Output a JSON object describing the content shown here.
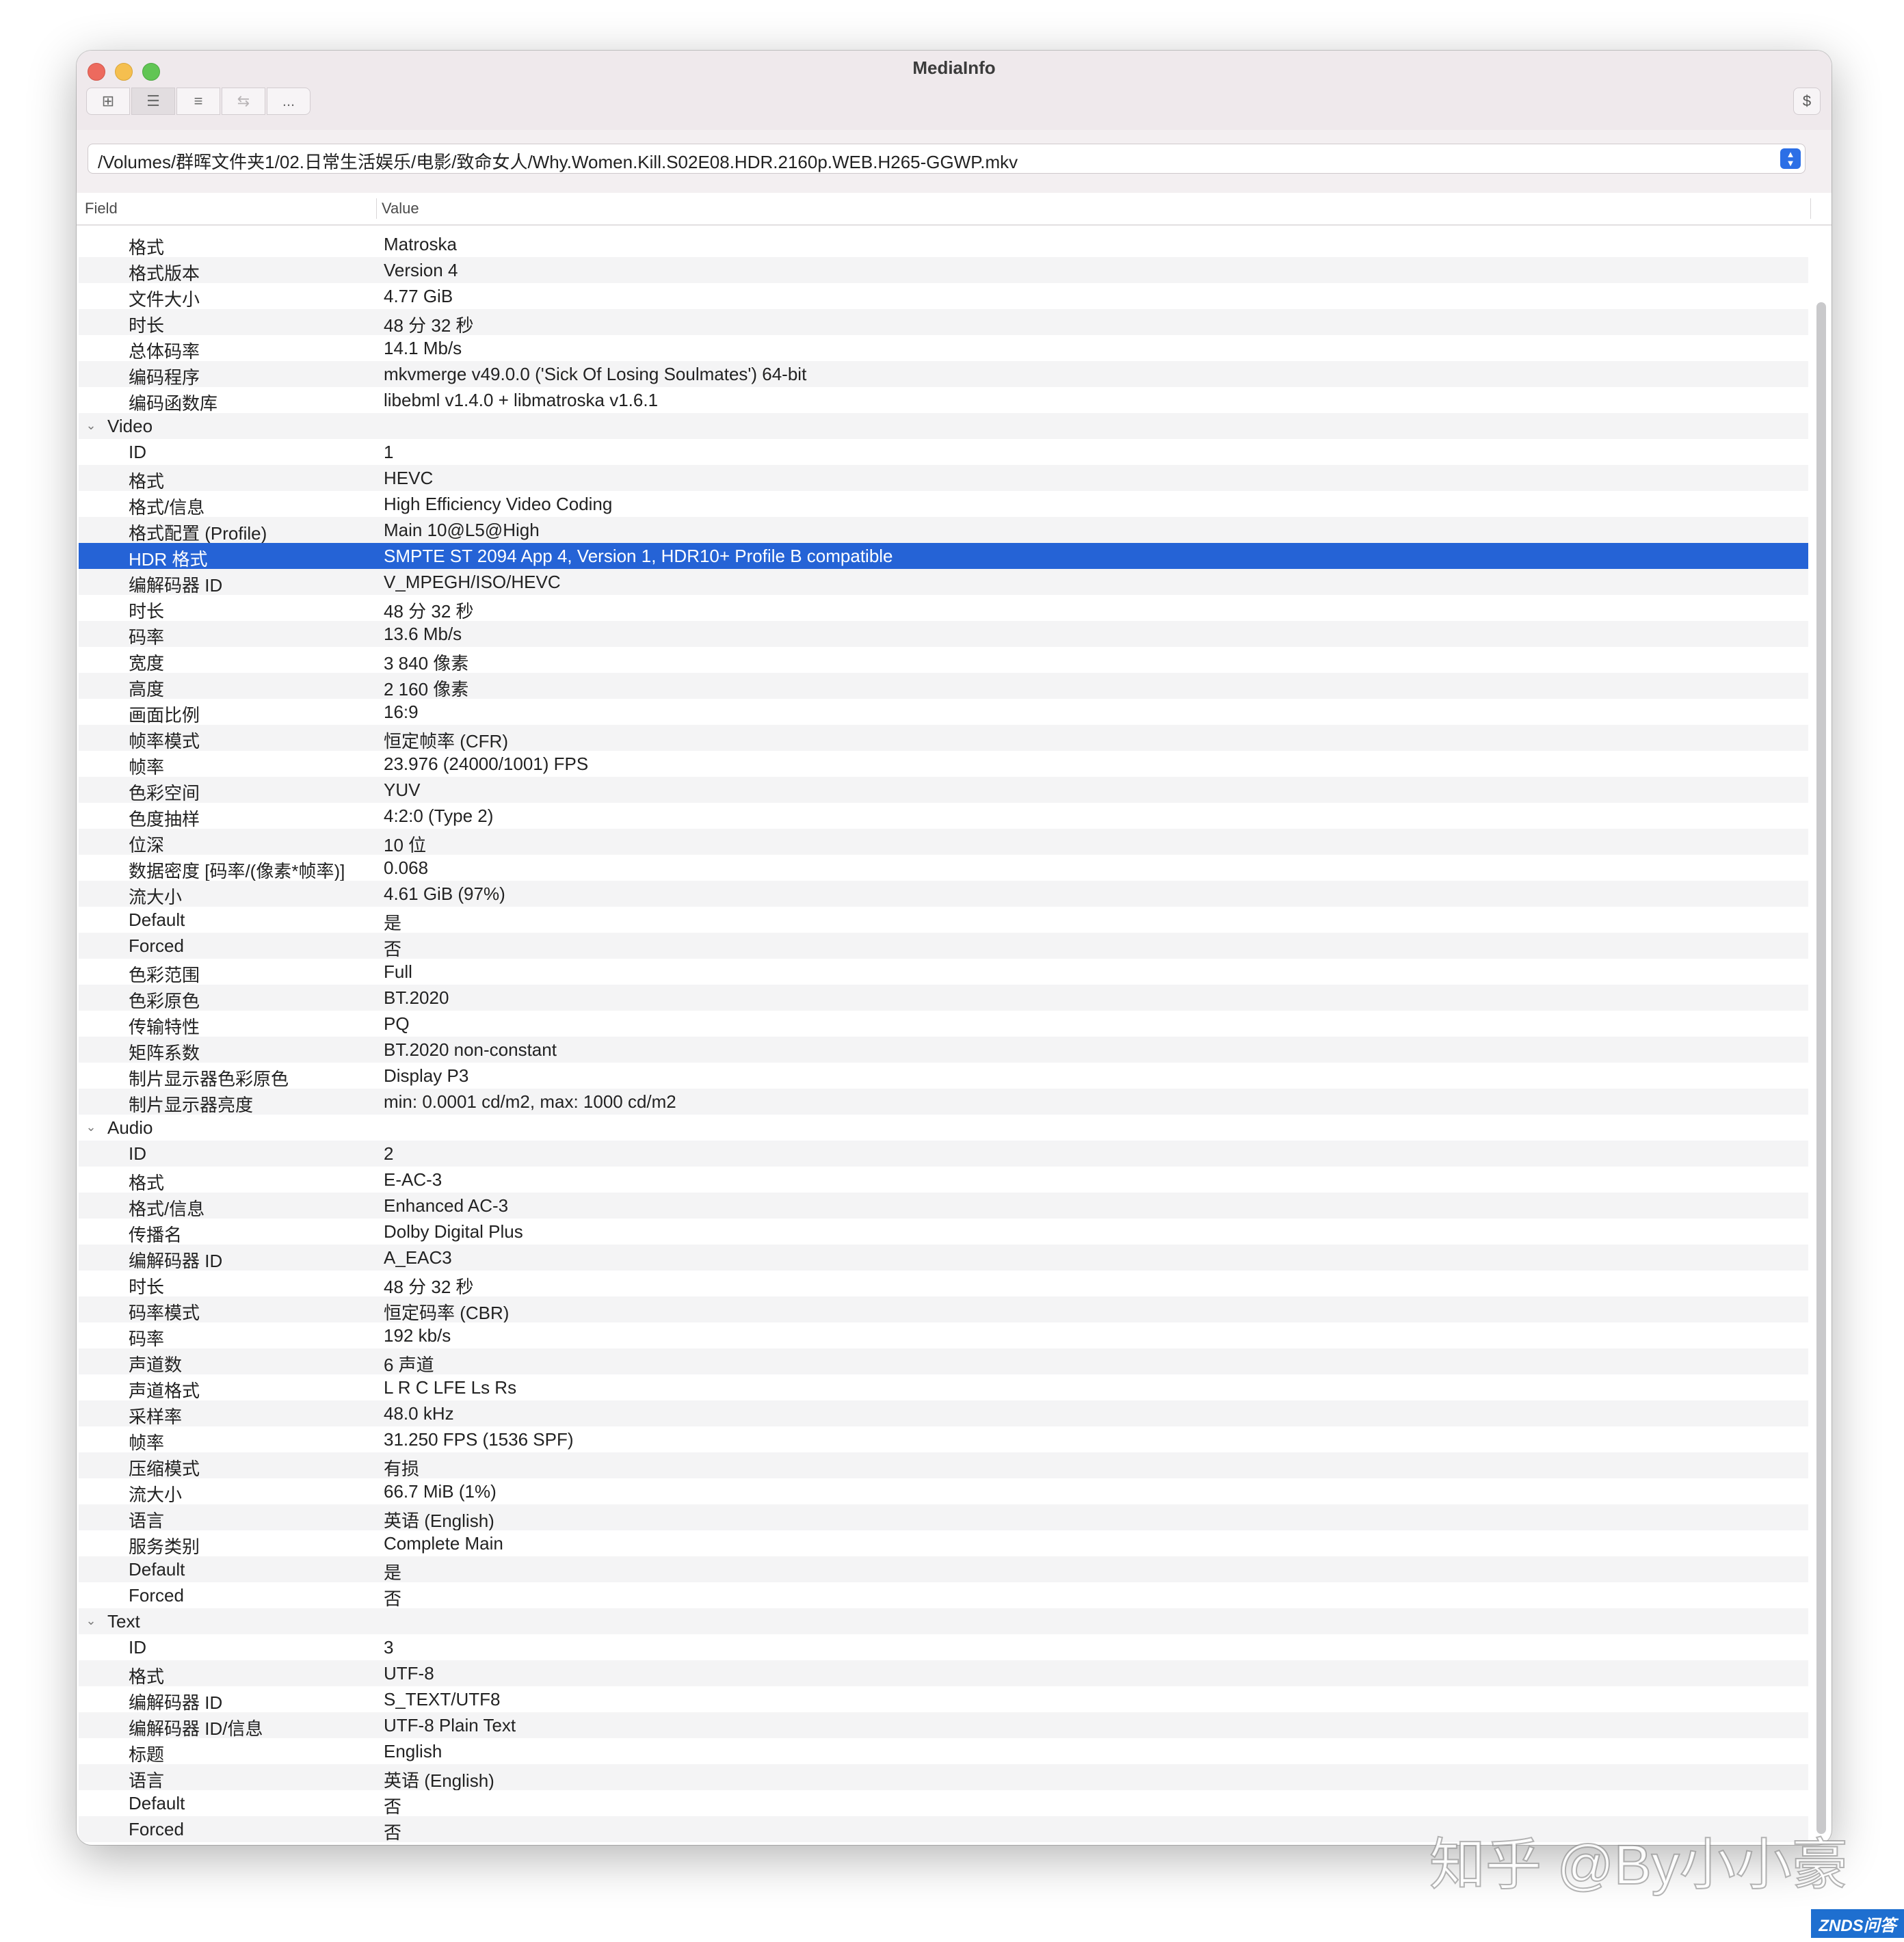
{
  "window": {
    "title": "MediaInfo"
  },
  "toolbar": {
    "buttons": [
      {
        "icon": "grid-view-icon",
        "glyph": "⊞"
      },
      {
        "icon": "tree-view-icon",
        "glyph": "☰"
      },
      {
        "icon": "text-view-icon",
        "glyph": "≡"
      },
      {
        "icon": "compare-icon",
        "glyph": "⇆"
      },
      {
        "icon": "more-icon",
        "glyph": "..."
      }
    ],
    "right_button": "$"
  },
  "path": {
    "value": "/Volumes/群晖文件夹1/02.日常生活娱乐/电影/致命女人/Why.Women.Kill.S02E08.HDR.2160p.WEB.H265-GGWP.mkv"
  },
  "table": {
    "headers": {
      "field": "Field",
      "value": "Value"
    },
    "rows": [
      {
        "f": "格式",
        "v": "Matroska"
      },
      {
        "f": "格式版本",
        "v": "Version 4"
      },
      {
        "f": "文件大小",
        "v": "4.77 GiB"
      },
      {
        "f": "时长",
        "v": "48 分 32 秒"
      },
      {
        "f": "总体码率",
        "v": "14.1 Mb/s"
      },
      {
        "f": "编码程序",
        "v": "mkvmerge v49.0.0 ('Sick Of Losing Soulmates') 64-bit"
      },
      {
        "f": "编码函数库",
        "v": "libebml v1.4.0 + libmatroska v1.6.1"
      },
      {
        "section": true,
        "f": "Video",
        "v": ""
      },
      {
        "f": "ID",
        "v": "1"
      },
      {
        "f": "格式",
        "v": "HEVC"
      },
      {
        "f": "格式/信息",
        "v": "High Efficiency Video Coding"
      },
      {
        "f": "格式配置 (Profile)",
        "v": "Main 10@L5@High"
      },
      {
        "f": "HDR 格式",
        "v": "SMPTE ST 2094 App 4, Version 1, HDR10+ Profile B compatible",
        "selected": true
      },
      {
        "f": "编解码器 ID",
        "v": "V_MPEGH/ISO/HEVC"
      },
      {
        "f": "时长",
        "v": "48 分 32 秒"
      },
      {
        "f": "码率",
        "v": "13.6 Mb/s"
      },
      {
        "f": "宽度",
        "v": "3 840 像素"
      },
      {
        "f": "高度",
        "v": "2 160 像素"
      },
      {
        "f": "画面比例",
        "v": "16:9"
      },
      {
        "f": "帧率模式",
        "v": "恒定帧率 (CFR)"
      },
      {
        "f": "帧率",
        "v": "23.976 (24000/1001) FPS"
      },
      {
        "f": "色彩空间",
        "v": "YUV"
      },
      {
        "f": "色度抽样",
        "v": "4:2:0 (Type 2)"
      },
      {
        "f": "位深",
        "v": "10 位"
      },
      {
        "f": "数据密度 [码率/(像素*帧率)]",
        "v": "0.068"
      },
      {
        "f": "流大小",
        "v": "4.61 GiB (97%)"
      },
      {
        "f": "Default",
        "v": "是"
      },
      {
        "f": "Forced",
        "v": "否"
      },
      {
        "f": "色彩范围",
        "v": "Full"
      },
      {
        "f": "色彩原色",
        "v": "BT.2020"
      },
      {
        "f": "传输特性",
        "v": "PQ"
      },
      {
        "f": "矩阵系数",
        "v": "BT.2020 non-constant"
      },
      {
        "f": "制片显示器色彩原色",
        "v": "Display P3"
      },
      {
        "f": "制片显示器亮度",
        "v": "min: 0.0001 cd/m2, max: 1000 cd/m2"
      },
      {
        "section": true,
        "f": "Audio",
        "v": ""
      },
      {
        "f": "ID",
        "v": "2"
      },
      {
        "f": "格式",
        "v": "E-AC-3"
      },
      {
        "f": "格式/信息",
        "v": "Enhanced AC-3"
      },
      {
        "f": "传播名",
        "v": "Dolby Digital Plus"
      },
      {
        "f": "编解码器 ID",
        "v": "A_EAC3"
      },
      {
        "f": "时长",
        "v": "48 分 32 秒"
      },
      {
        "f": "码率模式",
        "v": "恒定码率 (CBR)"
      },
      {
        "f": "码率",
        "v": "192 kb/s"
      },
      {
        "f": "声道数",
        "v": "6 声道"
      },
      {
        "f": "声道格式",
        "v": "L R C LFE Ls Rs"
      },
      {
        "f": "采样率",
        "v": "48.0 kHz"
      },
      {
        "f": "帧率",
        "v": "31.250 FPS (1536 SPF)"
      },
      {
        "f": "压缩模式",
        "v": "有损"
      },
      {
        "f": "流大小",
        "v": "66.7 MiB (1%)"
      },
      {
        "f": "语言",
        "v": "英语 (English)"
      },
      {
        "f": "服务类别",
        "v": "Complete Main"
      },
      {
        "f": "Default",
        "v": "是"
      },
      {
        "f": "Forced",
        "v": "否"
      },
      {
        "section": true,
        "f": "Text",
        "v": ""
      },
      {
        "f": "ID",
        "v": "3"
      },
      {
        "f": "格式",
        "v": "UTF-8"
      },
      {
        "f": "编解码器 ID",
        "v": "S_TEXT/UTF8"
      },
      {
        "f": "编解码器 ID/信息",
        "v": "UTF-8 Plain Text"
      },
      {
        "f": "标题",
        "v": "English"
      },
      {
        "f": "语言",
        "v": "英语 (English)"
      },
      {
        "f": "Default",
        "v": "否"
      },
      {
        "f": "Forced",
        "v": "否"
      }
    ]
  },
  "watermark": {
    "text": "知乎 @By小小豪",
    "badge": "ZNDS问答"
  },
  "colors": {
    "selection": "#2563d6",
    "accent": "#2c6fe6"
  }
}
